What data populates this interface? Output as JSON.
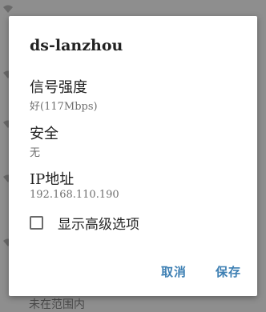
{
  "dialog": {
    "title": "ds-lanzhou",
    "signal": {
      "label": "信号强度",
      "value": "好(117Mbps)"
    },
    "security": {
      "label": "安全",
      "value": "无"
    },
    "ip": {
      "label": "IP地址",
      "value": "192.168.110.190"
    },
    "advanced_checkbox": {
      "label": "显示高级选项",
      "checked": false
    },
    "buttons": {
      "cancel": "取消",
      "save": "保存"
    }
  },
  "background": {
    "visible_partial_text": "未在范围内"
  },
  "colors": {
    "accent": "#3d7fb3",
    "scrim": "#8e8e8e",
    "dialog_bg": "#ffffff"
  },
  "icons": [
    "wifi-icon"
  ]
}
